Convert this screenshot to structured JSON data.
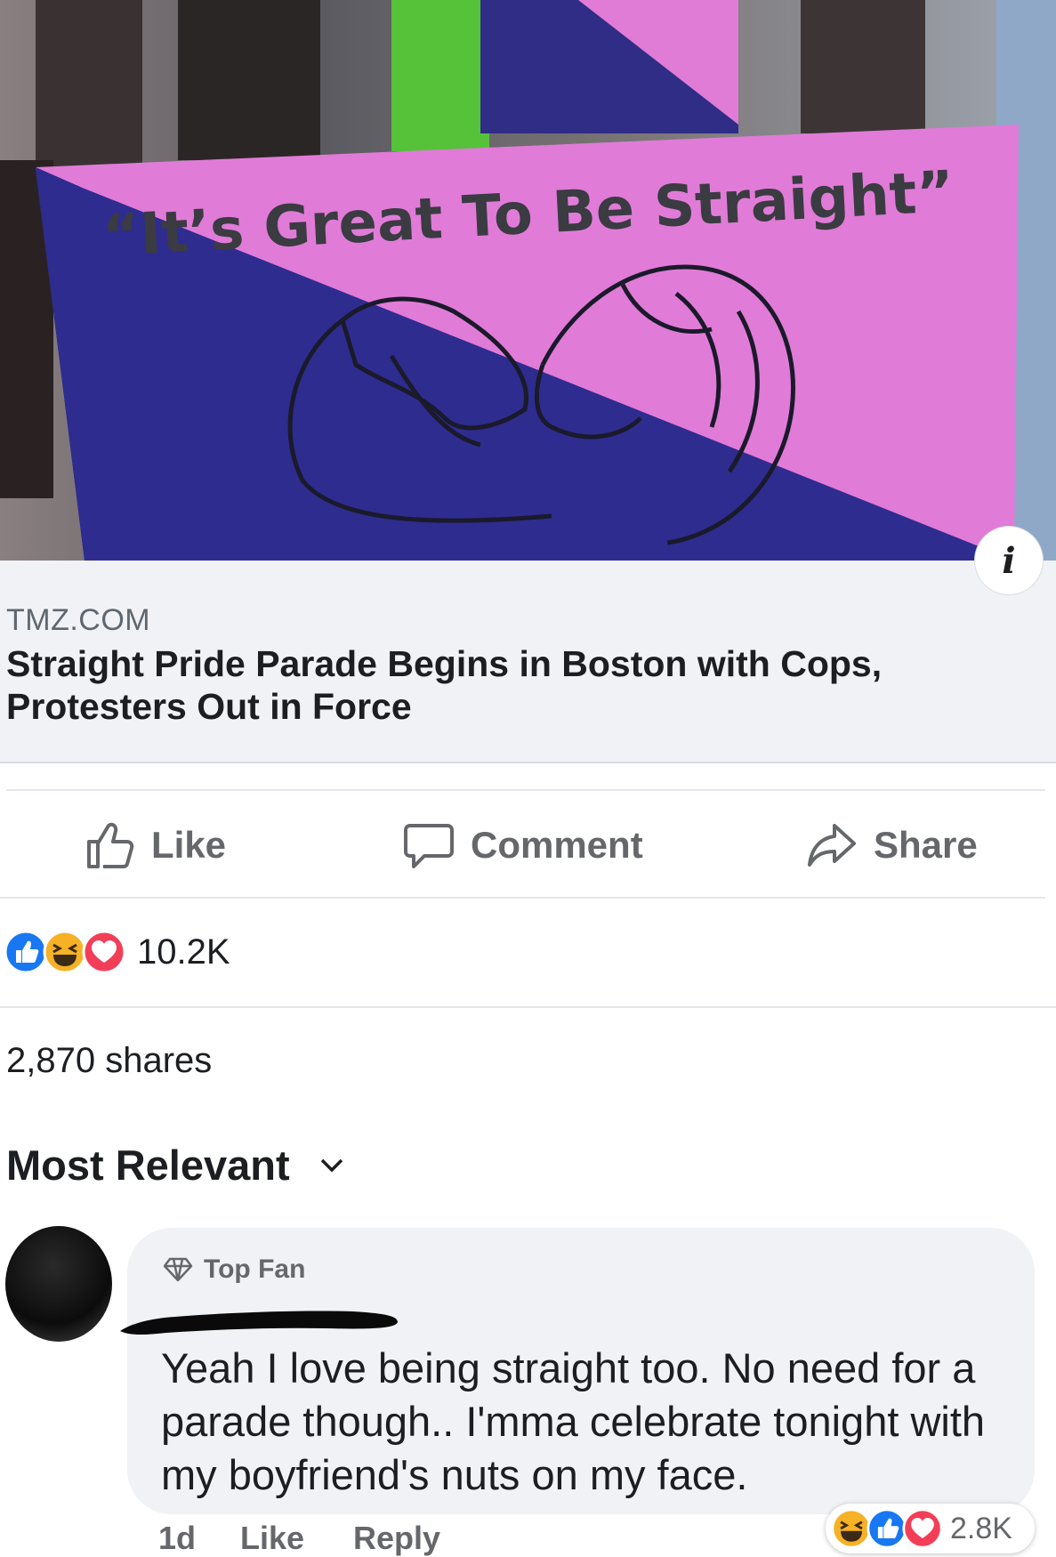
{
  "hero": {
    "banner_text": "“It’s Great To Be Straight”",
    "info_icon": "i"
  },
  "link_preview": {
    "domain": "TMZ.COM",
    "headline": "Straight Pride Parade Begins in Boston with Cops, Protesters Out in Force"
  },
  "actions": {
    "like": "Like",
    "comment": "Comment",
    "share": "Share"
  },
  "reactions": {
    "icons": [
      "like-icon",
      "haha-icon",
      "love-icon"
    ],
    "count": "10.2K"
  },
  "shares": "2,870 shares",
  "sort": {
    "label": "Most Relevant"
  },
  "comment": {
    "badge": "Top Fan",
    "text": "Yeah I love being straight too. No need for a parade though.. I'mma celebrate tonight with my boyfriend's nuts on my face.",
    "time": "1d",
    "like": "Like",
    "reply": "Reply",
    "reaction_icons": [
      "haha-icon",
      "like-icon",
      "love-icon"
    ],
    "reaction_count": "2.8K"
  },
  "colors": {
    "like_blue": "#1877f2",
    "love_red": "#f33e58",
    "haha_yellow": "#f7b125",
    "banner_pink": "#e17bd8",
    "banner_blue": "#2e2c8f"
  }
}
